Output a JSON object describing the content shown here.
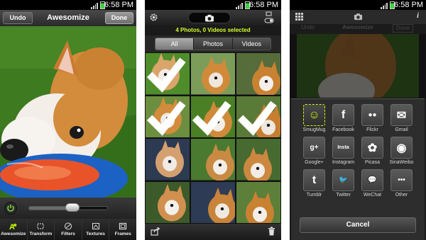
{
  "status_bar": {
    "time": "6:58 PM"
  },
  "editor": {
    "undo_label": "Undo",
    "title": "Awesomize",
    "done_label": "Done",
    "slider_value": 0.55,
    "tools": [
      {
        "label": "Awesomize",
        "icon": "magic-wand-icon",
        "active": true
      },
      {
        "label": "Transform",
        "icon": "crop-icon",
        "active": false
      },
      {
        "label": "Filters",
        "icon": "filters-icon",
        "active": false
      },
      {
        "label": "Textures",
        "icon": "textures-icon",
        "active": false
      },
      {
        "label": "Frames",
        "icon": "frames-icon",
        "active": false
      }
    ]
  },
  "gallery": {
    "selection_text": "4 Photos, 0 Videos selected",
    "tabs": [
      {
        "label": "All",
        "active": true
      },
      {
        "label": "Photos",
        "active": false
      },
      {
        "label": "Videos",
        "active": false
      }
    ],
    "selected_thumbs": [
      0,
      3,
      4,
      5
    ]
  },
  "share": {
    "behind_bar": {
      "undo_label": "Undo",
      "title": "Awesomize",
      "done_label": "Done"
    },
    "services": [
      {
        "label": "SmugMug",
        "icon": "smugmug-icon",
        "glyph": "☺"
      },
      {
        "label": "Facebook",
        "icon": "facebook-icon",
        "glyph": "f"
      },
      {
        "label": "Flickr",
        "icon": "flickr-icon",
        "glyph": "●●"
      },
      {
        "label": "Gmail",
        "icon": "gmail-icon",
        "glyph": "✉"
      },
      {
        "label": "Google+",
        "icon": "googleplus-icon",
        "glyph": "g+"
      },
      {
        "label": "Instagram",
        "icon": "instagram-icon",
        "glyph": "Insta"
      },
      {
        "label": "Picasa",
        "icon": "picasa-icon",
        "glyph": "✿"
      },
      {
        "label": "SinaWeibo",
        "icon": "sinaweibo-icon",
        "glyph": "◉"
      },
      {
        "label": "Tumblr",
        "icon": "tumblr-icon",
        "glyph": "t"
      },
      {
        "label": "Twitter",
        "icon": "twitter-icon",
        "glyph": "🐦"
      },
      {
        "label": "WeChat",
        "icon": "wechat-icon",
        "glyph": "💬"
      },
      {
        "label": "Other",
        "icon": "more-icon",
        "glyph": "•••"
      }
    ],
    "cancel_label": "Cancel"
  },
  "colors": {
    "accent_green": "#c8ff00",
    "selection_text": "#d5ff2a",
    "grass": "#3f7a1e",
    "dog_orange": "#d08a3a",
    "frisbee_orange": "#e8532a",
    "frisbee_blue": "#1b62c4"
  }
}
